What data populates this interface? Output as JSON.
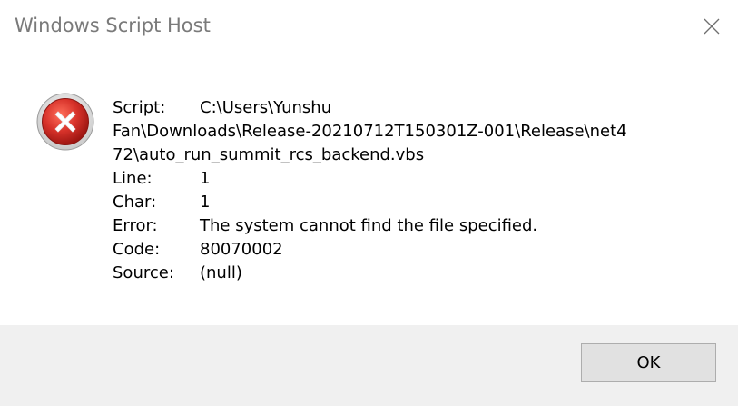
{
  "window": {
    "title": "Windows Script Host",
    "close_icon": "close-icon"
  },
  "icon": {
    "name": "error-icon",
    "color": "#c42b1c"
  },
  "message": {
    "script_label": "Script:",
    "script_path_line1": "C:\\Users\\Yunshu",
    "script_path_line2": "Fan\\Downloads\\Release-20210712T150301Z-001\\Release\\net4",
    "script_path_line3": "72\\auto_run_summit_rcs_backend.vbs",
    "line_label": "Line:",
    "line_value": "1",
    "char_label": "Char:",
    "char_value": "1",
    "error_label": "Error:",
    "error_value": "The system cannot find the file specified.",
    "code_label": "Code:",
    "code_value": "80070002",
    "source_label": "Source:",
    "source_value": "(null)"
  },
  "footer": {
    "ok_label": "OK"
  }
}
